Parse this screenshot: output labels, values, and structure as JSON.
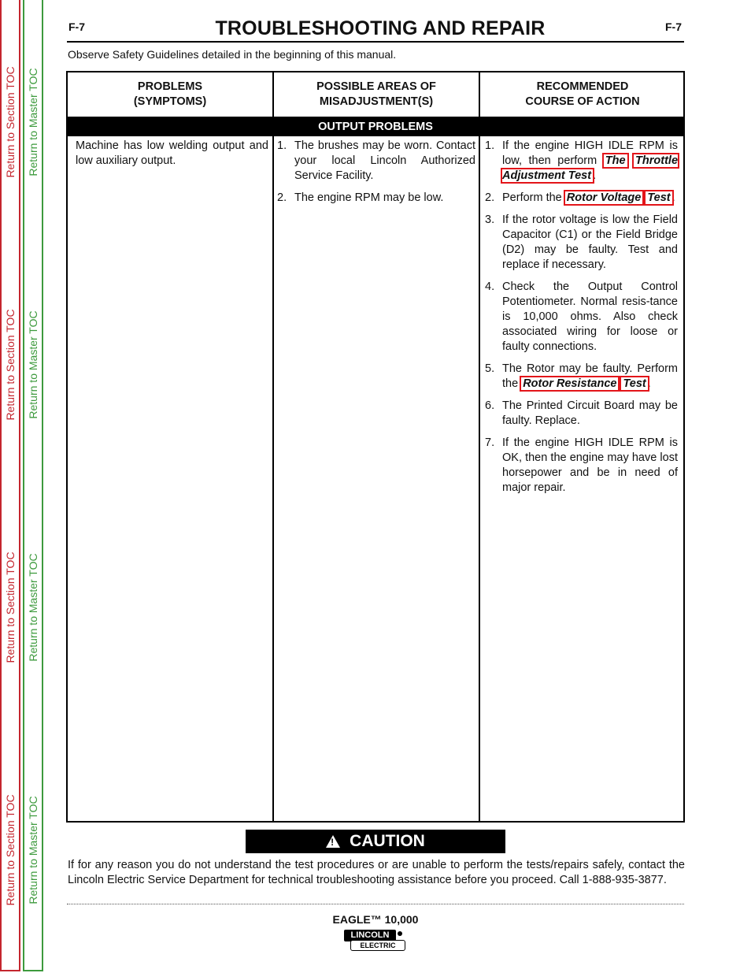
{
  "toc": {
    "section_label": "Return to Section TOC",
    "master_label": "Return to Master TOC",
    "colors": {
      "section": "#c4262e",
      "master": "#3d9a3d"
    }
  },
  "header": {
    "page_id": "F-7",
    "title": "TROUBLESHOOTING AND REPAIR",
    "safety_note": "Observe Safety Guidelines detailed in the beginning of this manual."
  },
  "table": {
    "headers": [
      {
        "line1": "PROBLEMS",
        "line2": "(SYMPTOMS)"
      },
      {
        "line1": "POSSIBLE AREAS OF",
        "line2": "MISADJUSTMENT(S)"
      },
      {
        "line1": "RECOMMENDED",
        "line2": "COURSE OF ACTION"
      }
    ],
    "section_band": "OUTPUT PROBLEMS",
    "symptom": "Machine has low welding output and low auxiliary output.",
    "misadjustments": [
      {
        "num": "1.",
        "text": "The brushes may be worn. Contact your local Lincoln Authorized Service Facility."
      },
      {
        "num": "2.",
        "text": "The engine RPM may be low."
      }
    ],
    "actions": [
      {
        "num": "1.",
        "before": "If the engine HIGH IDLE RPM is low, then perform ",
        "link_a": "The",
        "link_b": "Throttle Adjustment Test",
        "after": "."
      },
      {
        "num": "2.",
        "before": "Perform the ",
        "link_a": "Rotor Voltage",
        "link_b": "Test",
        "after": "."
      },
      {
        "num": "3.",
        "text": "If the rotor voltage is low the Field Capacitor (C1) or the Field Bridge (D2) may be faulty.  Test and replace if necessary."
      },
      {
        "num": "4.",
        "text": "Check the Output Control Potentiometer.  Normal resis-tance is 10,000 ohms.  Also check associated wiring for loose or faulty connections."
      },
      {
        "num": "5.",
        "before": "The Rotor may be faulty. Perform the ",
        "link_a": "Rotor Resistance",
        "link_b": "Test",
        "after": "."
      },
      {
        "num": "6.",
        "text": "The Printed Circuit Board may be faulty.  Replace."
      },
      {
        "num": "7.",
        "text": "If the engine HIGH IDLE RPM is OK, then the engine may have lost horsepower and be in need of major repair."
      }
    ]
  },
  "caution": {
    "icon": "warning-triangle-icon",
    "label": "CAUTION",
    "text": "If for any reason you do not understand the test procedures or are unable to perform the tests/repairs safely, contact the Lincoln Electric Service Department for technical troubleshooting assistance before you proceed. Call 1-888-935-3877."
  },
  "footer": {
    "model": "EAGLE™ 10,000",
    "logo_top": "LINCOLN",
    "logo_bottom": "ELECTRIC",
    "link_outline_color": "#e3151a"
  }
}
